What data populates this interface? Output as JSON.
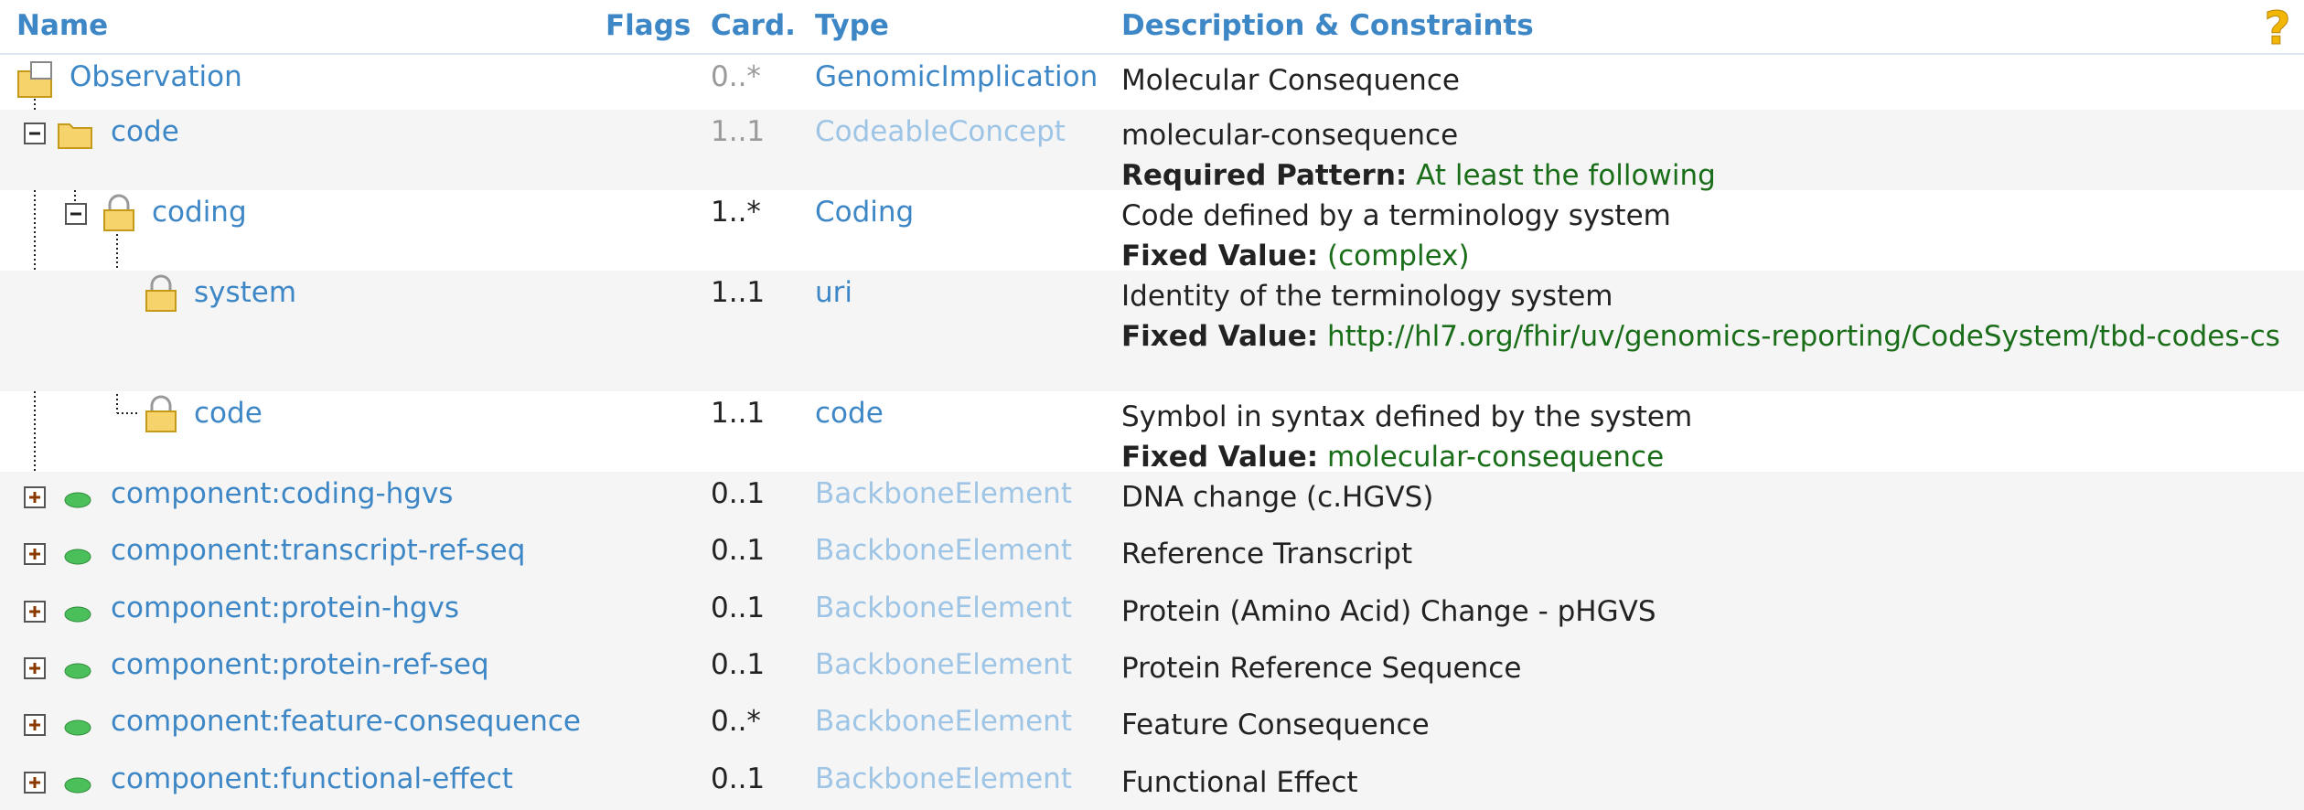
{
  "header": {
    "name": "Name",
    "flags": "Flags",
    "card": "Card.",
    "type": "Type",
    "desc": "Description & Constraints"
  },
  "rows": [
    {
      "name": "Observation",
      "card": "0..*",
      "type": "GenomicImplication",
      "desc": "Molecular Consequence"
    },
    {
      "name": "code",
      "card": "1..1",
      "type": "CodeableConcept",
      "desc": "molecular-consequence",
      "label": "Required Pattern:",
      "value": "At least the following"
    },
    {
      "name": "coding",
      "card": "1..*",
      "type": "Coding",
      "desc": "Code defined by a terminology system",
      "label": "Fixed Value:",
      "value": "(complex)"
    },
    {
      "name": "system",
      "card": "1..1",
      "type": "uri",
      "desc": "Identity of the terminology system",
      "label": "Fixed Value:",
      "value": "http://hl7.org/fhir/uv/genomics-reporting/CodeSystem/tbd-codes-cs"
    },
    {
      "name": "code",
      "card": "1..1",
      "type": "code",
      "desc": "Symbol in syntax defined by the system",
      "label": "Fixed Value:",
      "value": "molecular-consequence"
    },
    {
      "name": "component:coding-hgvs",
      "card": "0..1",
      "type": "BackboneElement",
      "desc": "DNA change (c.HGVS)"
    },
    {
      "name": "component:transcript-ref-seq",
      "card": "0..1",
      "type": "BackboneElement",
      "desc": "Reference Transcript"
    },
    {
      "name": "component:protein-hgvs",
      "card": "0..1",
      "type": "BackboneElement",
      "desc": "Protein (Amino Acid) Change - pHGVS"
    },
    {
      "name": "component:protein-ref-seq",
      "card": "0..1",
      "type": "BackboneElement",
      "desc": "Protein Reference Sequence"
    },
    {
      "name": "component:feature-consequence",
      "card": "0..*",
      "type": "BackboneElement",
      "desc": "Feature Consequence"
    },
    {
      "name": "component:functional-effect",
      "card": "0..1",
      "type": "BackboneElement",
      "desc": "Functional Effect"
    }
  ],
  "icons": {
    "help": "help-icon",
    "resource": "resource-folder-icon",
    "folder": "folder-icon",
    "locked_folder": "locked-folder-icon",
    "locked": "lock-icon",
    "collapse": "collapse-minus-icon",
    "expand": "expand-plus-icon",
    "element": "element-icon"
  },
  "colors": {
    "link": "#3d87c6",
    "muted_link": "#9ec5e6",
    "muted_text": "#9a9a9a",
    "fixed_value": "#1a6e1a",
    "row_alt": "#f5f5f5"
  }
}
